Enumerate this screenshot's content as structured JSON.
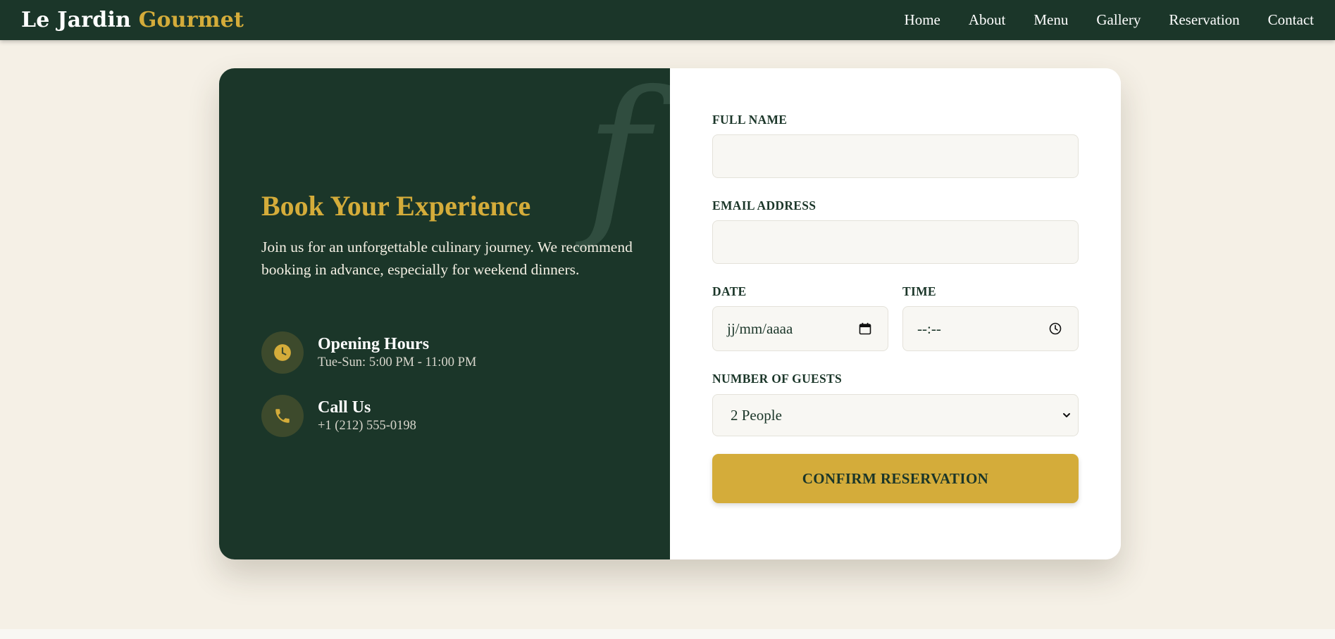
{
  "brand": {
    "name": "Le Jardin",
    "accent": "Gourmet"
  },
  "nav": {
    "items": [
      {
        "label": "Home"
      },
      {
        "label": "About"
      },
      {
        "label": "Menu"
      },
      {
        "label": "Gallery"
      },
      {
        "label": "Reservation"
      },
      {
        "label": "Contact"
      }
    ]
  },
  "booking": {
    "decoration": "f",
    "title": "Book Your Experience",
    "intro": "Join us for an unforgettable culinary journey. We recommend booking in advance, especially for weekend dinners.",
    "hours": {
      "heading": "Opening Hours",
      "detail": "Tue-Sun: 5:00 PM - 11:00 PM",
      "icon": "clock-icon"
    },
    "phone": {
      "heading": "Call Us",
      "detail": "+1 (212) 555-0198",
      "icon": "phone-icon"
    }
  },
  "form": {
    "name_label": "FULL NAME",
    "name_value": "",
    "email_label": "EMAIL ADDRESS",
    "email_value": "",
    "date_label": "DATE",
    "date_placeholder": "jj/mm/aaaa",
    "time_label": "TIME",
    "time_placeholder": "--:--",
    "guests_label": "NUMBER OF GUESTS",
    "guests_selected": "2 People",
    "submit_label": "CONFIRM RESERVATION"
  },
  "colors": {
    "primary": "#1b3629",
    "accent": "#d4ac3a",
    "background": "#f5f0e6",
    "field_bg": "#f8f7f3"
  }
}
